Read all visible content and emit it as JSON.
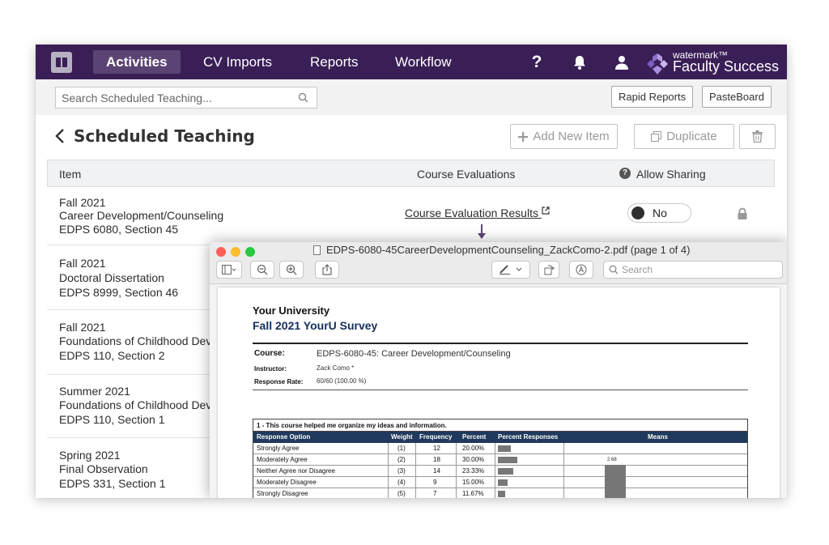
{
  "nav": {
    "tabs": [
      "Activities",
      "CV Imports",
      "Reports",
      "Workflow"
    ],
    "active_tab": "Activities",
    "help_label": "?",
    "brand_small": "watermark™",
    "brand_big": "Faculty Success"
  },
  "toolbar": {
    "search_placeholder": "Search Scheduled Teaching...",
    "rapid_reports": "Rapid Reports",
    "pasteboard": "PasteBoard"
  },
  "page": {
    "title": "Scheduled Teaching",
    "add_new_item": "Add New Item",
    "duplicate": "Duplicate"
  },
  "table": {
    "headers": {
      "item": "Item",
      "evaluations": "Course Evaluations",
      "sharing": "Allow Sharing"
    },
    "rows": [
      {
        "term": "Fall 2021",
        "title": "Career Development/Counseling",
        "section": "EDPS 6080, Section 45"
      },
      {
        "term": "Fall 2021",
        "title": "Doctoral Dissertation",
        "section": "EDPS 8999, Section 46"
      },
      {
        "term": "Fall 2021",
        "title": "Foundations of Childhood Dev",
        "section": "EDPS 110, Section 2"
      },
      {
        "term": "Summer 2021",
        "title": "Foundations of Childhood Dev",
        "section": "EDPS 110, Section 1"
      },
      {
        "term": "Spring 2021",
        "title": "Final Observation",
        "section": "EDPS 331, Section 1"
      }
    ],
    "eval_link": "Course Evaluation Results",
    "sharing_value": "No"
  },
  "pdf": {
    "window_title": "EDPS-6080-45CareerDevelopmentCounseling_ZackComo-2.pdf (page 1 of 4)",
    "search_placeholder": "Search",
    "university": "Your University",
    "survey": "Fall 2021 YourU Survey",
    "meta": [
      {
        "label": "Course:",
        "value": "EDPS-6080-45: Career Development/Counseling"
      },
      {
        "label": "Instructor:",
        "value": "Zack Como *"
      },
      {
        "label": "Response Rate:",
        "value": "60/60 (100.00 %)"
      }
    ],
    "question": "1 - This course helped me organize my ideas and information.",
    "columns": [
      "Response Option",
      "Weight",
      "Frequency",
      "Percent",
      "Percent Responses",
      "Means"
    ],
    "rows": [
      {
        "option": "Strongly Agree",
        "weight": "(1)",
        "frequency": "12",
        "percent": "20.00%",
        "pct": 20.0
      },
      {
        "option": "Moderately Agree",
        "weight": "(2)",
        "frequency": "18",
        "percent": "30.00%",
        "pct": 30.0
      },
      {
        "option": "Neither Agree nor Disagree",
        "weight": "(3)",
        "frequency": "14",
        "percent": "23.33%",
        "pct": 23.33
      },
      {
        "option": "Moderately Disagree",
        "weight": "(4)",
        "frequency": "9",
        "percent": "15.00%",
        "pct": 15.0
      },
      {
        "option": "Strongly Disagree",
        "weight": "(5)",
        "frequency": "7",
        "percent": "11.67%",
        "pct": 11.67
      }
    ],
    "mean_value": "2.68"
  },
  "colors": {
    "nav_bg": "#3a1f57",
    "nav_active": "#5b4474",
    "table_header_bg": "#1f3a5c",
    "bar": "#777777"
  },
  "icons": [
    "book-logo-icon",
    "help-icon",
    "bell-icon",
    "user-icon",
    "search-icon",
    "chevron-left-icon",
    "plus-icon",
    "copy-icon",
    "trash-icon",
    "external-link-icon",
    "lock-icon",
    "sidebar-icon",
    "zoom-out-icon",
    "zoom-in-icon",
    "share-icon",
    "markup-icon",
    "rotate-icon"
  ]
}
